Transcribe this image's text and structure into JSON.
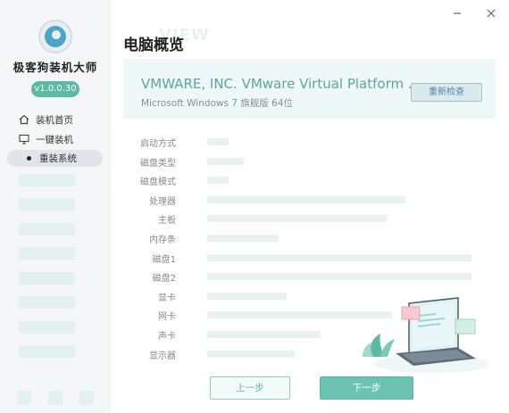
{
  "app": {
    "name": "极客狗装机大师",
    "version": "v1.0.0.30"
  },
  "window": {
    "minimize_icon": "minimize-icon",
    "close_icon": "close-icon"
  },
  "sidebar": {
    "items": [
      {
        "label": "装机首页",
        "icon": "home-icon"
      },
      {
        "label": "一键装机",
        "icon": "monitor-icon"
      },
      {
        "label": "重装系统",
        "icon": "dot-icon",
        "active": true
      }
    ]
  },
  "page": {
    "title": "电脑概览",
    "title_bg": "VIEW"
  },
  "banner": {
    "title": "VMWARE, INC. VMware Virtual Platform ...",
    "subtitle": "Microsoft Windows 7 旗舰版  64位",
    "recheck_label": "重新检查"
  },
  "specs": [
    {
      "label": "启动方式",
      "fill": 0.08
    },
    {
      "label": "磁盘类型",
      "fill": 0.14
    },
    {
      "label": "磁盘模式",
      "fill": 0.08
    },
    {
      "label": "处理器",
      "fill": 0.75
    },
    {
      "label": "主板",
      "fill": 0.68
    },
    {
      "label": "内存条",
      "fill": 0.27
    },
    {
      "label": "磁盘1",
      "fill": 1.0
    },
    {
      "label": "磁盘2",
      "fill": 1.0
    },
    {
      "label": "显卡",
      "fill": 0.3
    },
    {
      "label": "网卡",
      "fill": 0.7
    },
    {
      "label": "声卡",
      "fill": 0.43
    },
    {
      "label": "显示器",
      "fill": 0.33
    }
  ],
  "footer": {
    "prev_label": "上一步",
    "next_label": "下一步"
  },
  "colors": {
    "accent": "#5cb9a2",
    "banner_text": "#5aa89a",
    "placeholder": "#e6f3f1"
  }
}
